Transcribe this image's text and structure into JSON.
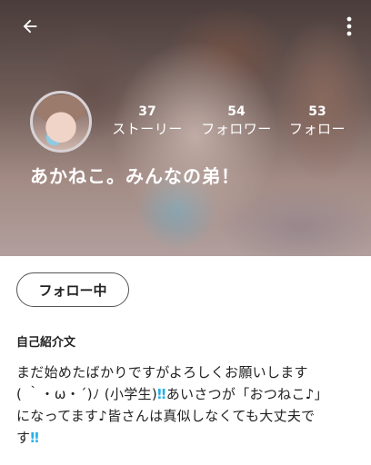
{
  "header": {
    "back_icon": "arrow-left-icon",
    "menu_icon": "more-vertical-icon"
  },
  "stats": [
    {
      "count": "37",
      "label": "ストーリー"
    },
    {
      "count": "54",
      "label": "フォロワー"
    },
    {
      "count": "53",
      "label": "フォロー"
    }
  ],
  "profile": {
    "name": "あかねこ。みんなの弟！"
  },
  "follow_button": {
    "label": "フォロー中"
  },
  "bio": {
    "title": "自己紹介文",
    "line1": "まだ始めたばかりですがよろしくお願いします",
    "line2a": "( ｀・ω・´)ﾉ (小学生)",
    "line2b": "あいさつが「おつねこ♪」",
    "line3": "になってます♪皆さんは真似しなくても大丈夫で",
    "line4": "す",
    "emphasis": "‼",
    "emphasis_color": "#25b0e8"
  }
}
